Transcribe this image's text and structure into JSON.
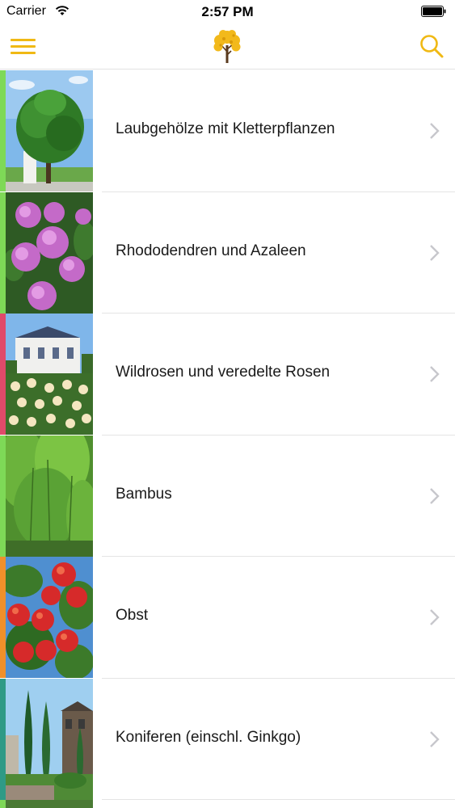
{
  "status_bar": {
    "carrier": "Carrier",
    "time": "2:57 PM"
  },
  "nav": {
    "menu_icon": "hamburger-icon",
    "logo_icon": "tree-logo-icon",
    "search_icon": "search-icon",
    "accent_color": "#f0b914"
  },
  "categories": [
    {
      "label": "Laubgehölze mit Kletterpflanzen",
      "accent": "#7ed957"
    },
    {
      "label": "Rhododendren und Azaleen",
      "accent": "#7ed957"
    },
    {
      "label": "Wildrosen und veredelte Rosen",
      "accent": "#e04a6a"
    },
    {
      "label": "Bambus",
      "accent": "#7ed957"
    },
    {
      "label": "Obst",
      "accent": "#f0902a"
    },
    {
      "label": "Koniferen (einschl. Ginkgo)",
      "accent": "#2f9a86"
    }
  ]
}
